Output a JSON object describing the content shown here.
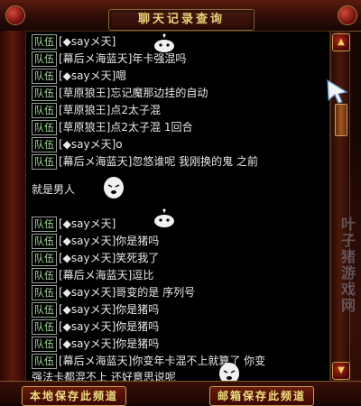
{
  "window": {
    "title": "聊天记录查询"
  },
  "channel_tag": "队伍",
  "messages": [
    {
      "text": "[◆sayメ天]"
    },
    {
      "text": "[幕后メ海蓝天]年卡强混吗"
    },
    {
      "text": "[◆sayメ天]嗯"
    },
    {
      "text": "[草原狼王]忘记魔那边挂的自动"
    },
    {
      "text": "[草原狼王]点2太子混"
    },
    {
      "text": "[草原狼王]点2太子混 1回合"
    },
    {
      "text": "[◆sayメ天]o"
    },
    {
      "text": "[幕后メ海蓝天]忽悠谁呢 我刚换的鬼 之前"
    },
    {
      "text": "[◆sayメ天]"
    },
    {
      "text": "[◆sayメ天]你是猪吗"
    },
    {
      "text": "[◆sayメ天]笑死我了"
    },
    {
      "text": "[幕后メ海蓝天]逗比"
    },
    {
      "text": "[◆sayメ天]哥变的是 序列号"
    },
    {
      "text": "[◆sayメ天]你是猪吗"
    },
    {
      "text": "[◆sayメ天]你是猪吗"
    },
    {
      "text": "[◆sayメ天]你是猪吗"
    },
    {
      "text": "[幕后メ海蓝天]你变年卡混不上就算了 你变"
    }
  ],
  "continuations": [
    {
      "text": "就是男人"
    },
    {
      "text": "强法卡都混不上 还好意思说呢"
    }
  ],
  "watermark": "叶子猪游戏网",
  "buttons": {
    "save_local": "本地保存此频道",
    "mail_save": "邮箱保存此频道"
  },
  "scroll": {
    "up": "▲",
    "down": "▼"
  },
  "icons": [
    "mascot-emoticon-icon",
    "cursor-arrow-icon"
  ]
}
